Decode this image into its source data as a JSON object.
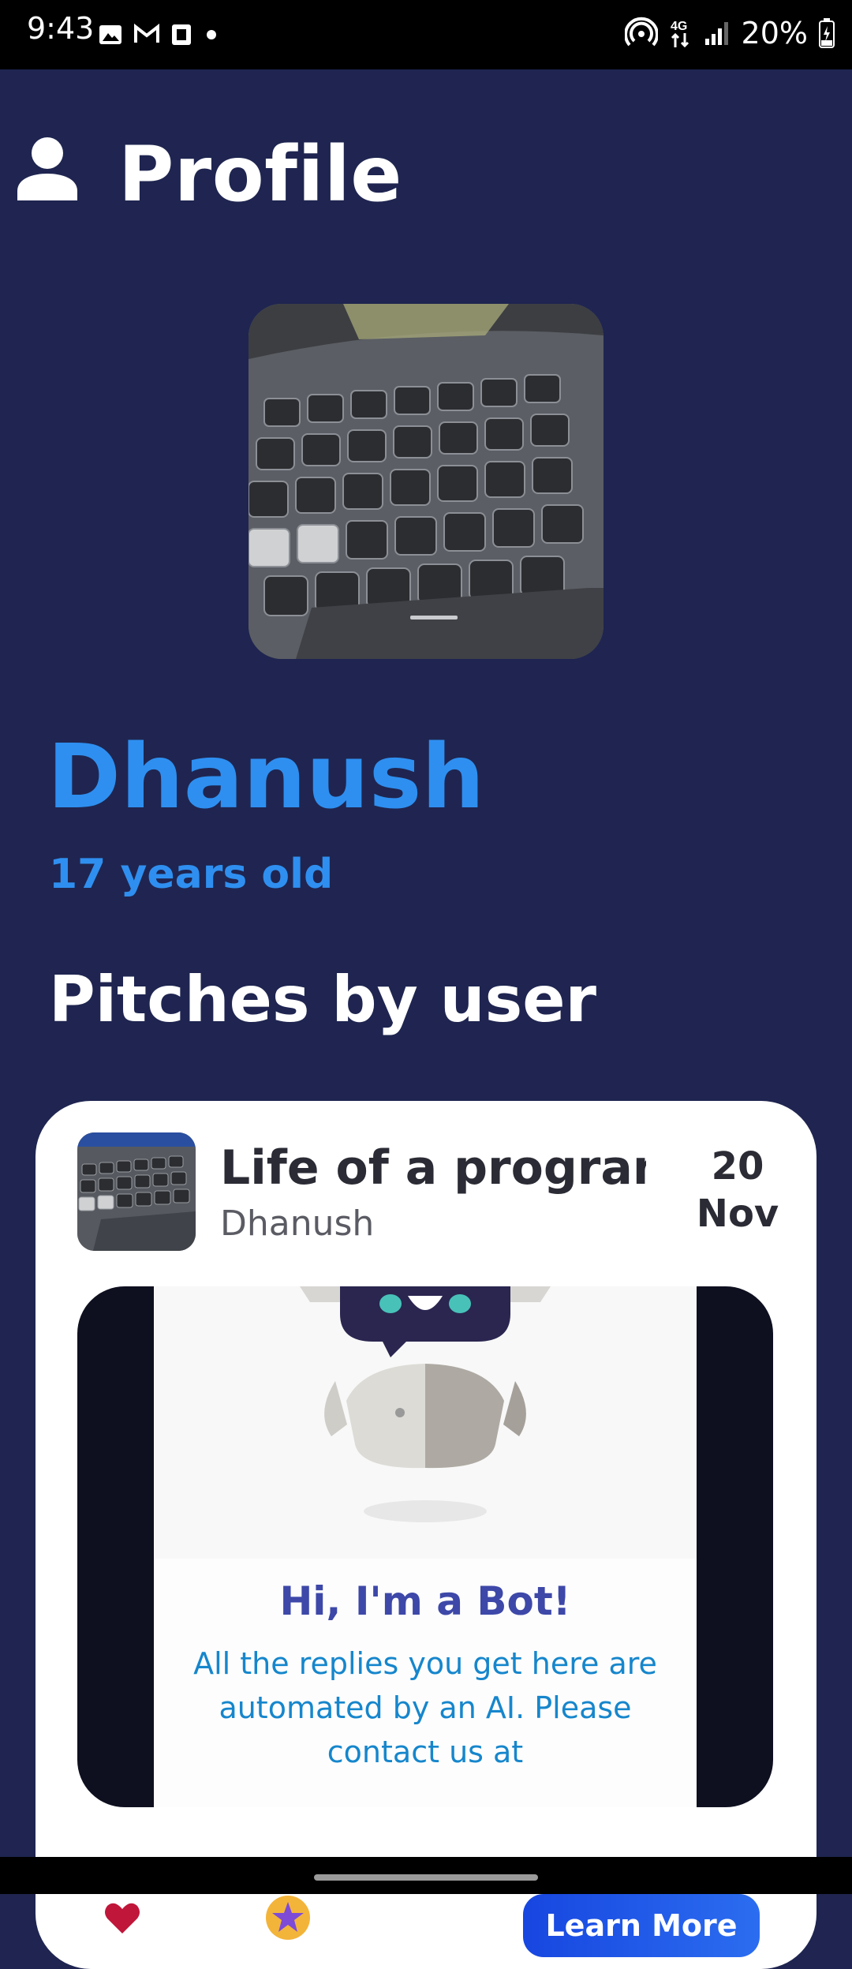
{
  "status_bar": {
    "time": "9:43",
    "battery": "20%",
    "network": "4G"
  },
  "header": {
    "title": "Profile",
    "icon": "person-icon"
  },
  "profile": {
    "name": "Dhanush",
    "age_text": "17 years old"
  },
  "section": {
    "title": "Pitches by user"
  },
  "pitch": {
    "title": "Life of a programne",
    "author": "Dhanush",
    "date_day": "20",
    "date_month": "Nov",
    "video": {
      "heading": "Hi, I'm a Bot!",
      "body": "All the replies you get here are automated by an AI. Please contact us at"
    },
    "button_label": "Learn More"
  },
  "colors": {
    "background": "#1f2550",
    "accent": "#2e8ff0",
    "card": "#ffffff"
  }
}
